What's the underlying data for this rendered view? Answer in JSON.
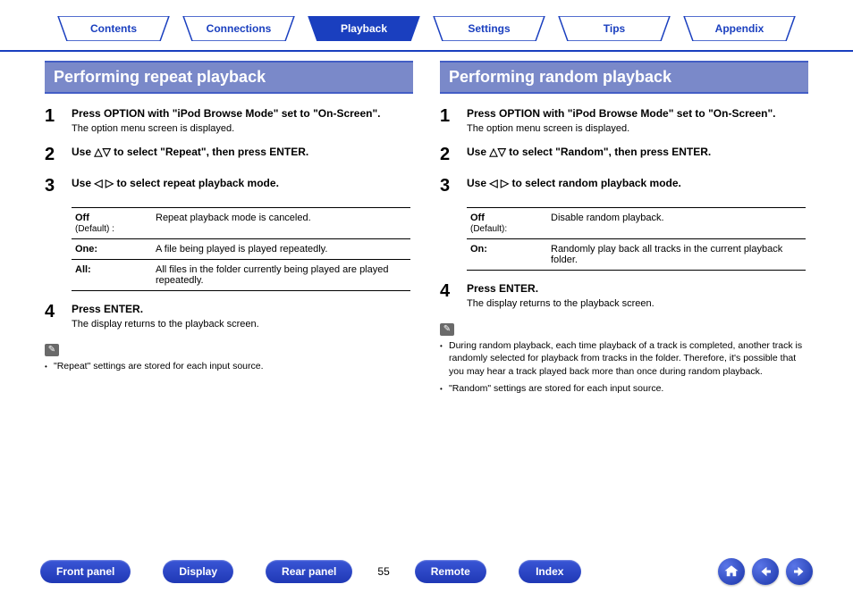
{
  "top_tabs": {
    "contents": "Contents",
    "connections": "Connections",
    "playback": "Playback",
    "settings": "Settings",
    "tips": "Tips",
    "appendix": "Appendix"
  },
  "left": {
    "header": "Performing repeat playback",
    "step1": {
      "title_a": "Press OPTION with \"iPod Browse Mode\" set to \"On-Screen\".",
      "sub": "The option menu screen is displayed."
    },
    "step2": {
      "pre": "Use ",
      "mid": " to select \"Repeat\", then press ENTER."
    },
    "step3": {
      "pre": "Use ",
      "mid": " to select repeat playback mode."
    },
    "table": {
      "r1_k": "Off",
      "r1_k2": "(Default) :",
      "r1_v": "Repeat playback mode is canceled.",
      "r2_k": "One:",
      "r2_v": "A file being played is played repeatedly.",
      "r3_k": "All:",
      "r3_v": "All files in the folder currently being played are played repeatedly."
    },
    "step4": {
      "title": "Press ENTER.",
      "sub": "The display returns to the playback screen."
    },
    "notes": {
      "n1": "\"Repeat\" settings are stored for each input source."
    }
  },
  "right": {
    "header": "Performing random playback",
    "step1": {
      "title_a": "Press OPTION with \"iPod Browse Mode\" set to \"On-Screen\".",
      "sub": "The option menu screen is displayed."
    },
    "step2": {
      "pre": "Use ",
      "mid": " to select \"Random\", then press ENTER."
    },
    "step3": {
      "pre": "Use ",
      "mid": " to select random playback mode."
    },
    "table": {
      "r1_k": "Off",
      "r1_k2": "(Default):",
      "r1_v": "Disable random playback.",
      "r2_k": "On:",
      "r2_v": "Randomly play back all tracks in the current playback folder."
    },
    "step4": {
      "title": "Press ENTER.",
      "sub": "The display returns to the playback screen."
    },
    "notes": {
      "n1": "During random playback, each time playback of a track is completed, another track is randomly selected for playback from tracks in the folder. Therefore, it's possible that you may hear a track played back more than once during random playback.",
      "n2": "\"Random\" settings are stored for each input source."
    }
  },
  "bottom": {
    "front_panel": "Front panel",
    "display": "Display",
    "rear_panel": "Rear panel",
    "page": "55",
    "remote": "Remote",
    "index": "Index"
  },
  "icons": {
    "up_down": "△▽",
    "left_right": "◁ ▷",
    "pencil": "✎"
  }
}
